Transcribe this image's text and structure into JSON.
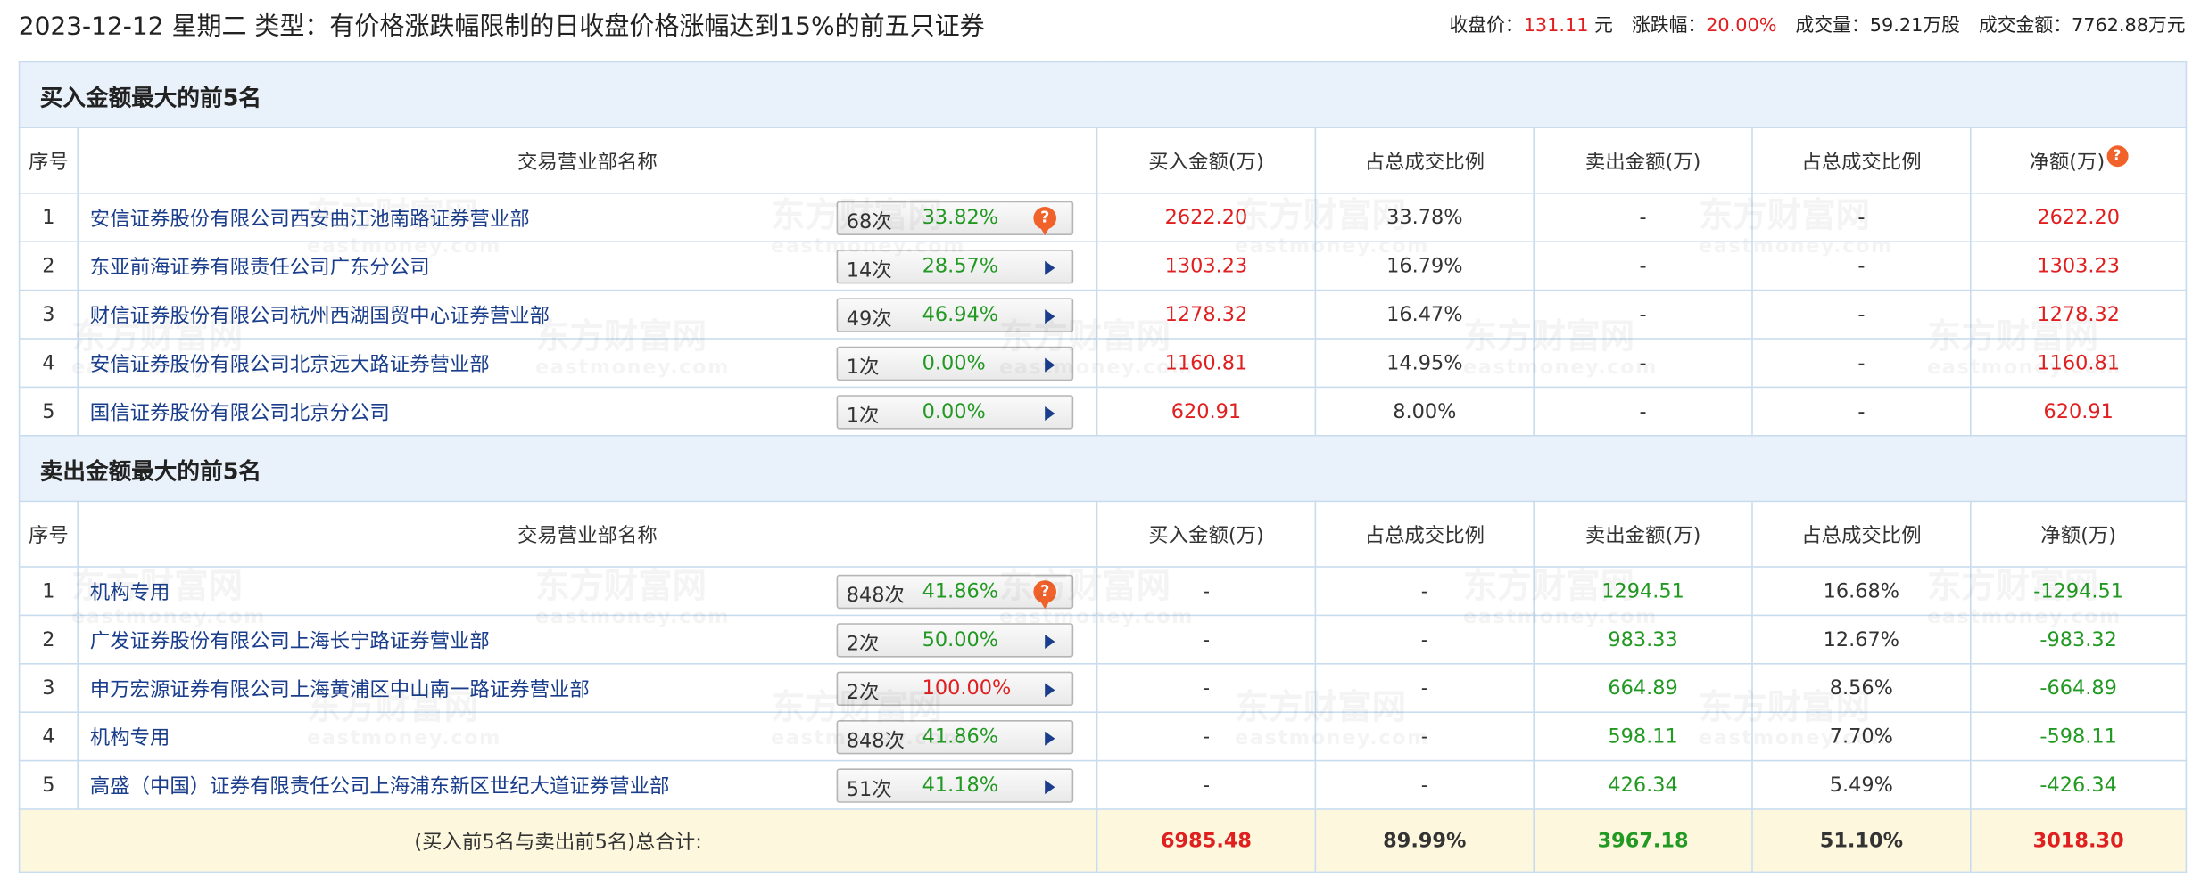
{
  "header": {
    "date": "2023-12-12",
    "weekday": "星期二",
    "type_label": "类型：",
    "type_value": "有价格涨跌幅限制的日收盘价格涨幅达到15%的前五只证券"
  },
  "summary": {
    "close_label": "收盘价：",
    "close_value": "131.11",
    "close_unit": "元",
    "change_label": "涨跌幅：",
    "change_value": "20.00%",
    "volume_label": "成交量：",
    "volume_value": "59.21万股",
    "amount_label": "成交金额：",
    "amount_value": "7762.88万元"
  },
  "columns": {
    "seq": "序号",
    "name": "交易营业部名称",
    "buy": "买入金额(万)",
    "buy_ratio": "占总成交比例",
    "sell": "卖出金额(万)",
    "sell_ratio": "占总成交比例",
    "net": "净额(万)"
  },
  "buy_section": {
    "title": "买入金额最大的前5名",
    "rows": [
      {
        "seq": "1",
        "name": "安信证券股份有限公司西安曲江池南路证券营业部",
        "count": "68次",
        "pct": "33.82%",
        "pct_color": "green",
        "icon": "question-bubble-icon",
        "buy": "2622.20",
        "buy_ratio": "33.78%",
        "sell": "-",
        "sell_ratio": "-",
        "net": "2622.20"
      },
      {
        "seq": "2",
        "name": "东亚前海证券有限责任公司广东分公司",
        "count": "14次",
        "pct": "28.57%",
        "pct_color": "green",
        "icon": "arrow-right-icon",
        "buy": "1303.23",
        "buy_ratio": "16.79%",
        "sell": "-",
        "sell_ratio": "-",
        "net": "1303.23"
      },
      {
        "seq": "3",
        "name": "财信证券股份有限公司杭州西湖国贸中心证券营业部",
        "count": "49次",
        "pct": "46.94%",
        "pct_color": "green",
        "icon": "arrow-right-icon",
        "buy": "1278.32",
        "buy_ratio": "16.47%",
        "sell": "-",
        "sell_ratio": "-",
        "net": "1278.32"
      },
      {
        "seq": "4",
        "name": "安信证券股份有限公司北京远大路证券营业部",
        "count": "1次",
        "pct": "0.00%",
        "pct_color": "green",
        "icon": "arrow-right-icon",
        "buy": "1160.81",
        "buy_ratio": "14.95%",
        "sell": "-",
        "sell_ratio": "-",
        "net": "1160.81"
      },
      {
        "seq": "5",
        "name": "国信证券股份有限公司北京分公司",
        "count": "1次",
        "pct": "0.00%",
        "pct_color": "green",
        "icon": "arrow-right-icon",
        "buy": "620.91",
        "buy_ratio": "8.00%",
        "sell": "-",
        "sell_ratio": "-",
        "net": "620.91"
      }
    ]
  },
  "sell_section": {
    "title": "卖出金额最大的前5名",
    "rows": [
      {
        "seq": "1",
        "name": "机构专用",
        "count": "848次",
        "pct": "41.86%",
        "pct_color": "green",
        "icon": "question-bubble-icon",
        "buy": "-",
        "buy_ratio": "-",
        "sell": "1294.51",
        "sell_ratio": "16.68%",
        "net": "-1294.51"
      },
      {
        "seq": "2",
        "name": "广发证券股份有限公司上海长宁路证券营业部",
        "count": "2次",
        "pct": "50.00%",
        "pct_color": "green",
        "icon": "arrow-right-icon",
        "buy": "-",
        "buy_ratio": "-",
        "sell": "983.33",
        "sell_ratio": "12.67%",
        "net": "-983.32"
      },
      {
        "seq": "3",
        "name": "申万宏源证券有限公司上海黄浦区中山南一路证券营业部",
        "count": "2次",
        "pct": "100.00%",
        "pct_color": "red",
        "icon": "arrow-right-icon",
        "buy": "-",
        "buy_ratio": "-",
        "sell": "664.89",
        "sell_ratio": "8.56%",
        "net": "-664.89"
      },
      {
        "seq": "4",
        "name": "机构专用",
        "count": "848次",
        "pct": "41.86%",
        "pct_color": "green",
        "icon": "arrow-right-icon",
        "buy": "-",
        "buy_ratio": "-",
        "sell": "598.11",
        "sell_ratio": "7.70%",
        "net": "-598.11"
      },
      {
        "seq": "5",
        "name": "高盛（中国）证券有限责任公司上海浦东新区世纪大道证券营业部",
        "count": "51次",
        "pct": "41.18%",
        "pct_color": "green",
        "icon": "arrow-right-icon",
        "buy": "-",
        "buy_ratio": "-",
        "sell": "426.34",
        "sell_ratio": "5.49%",
        "net": "-426.34"
      }
    ]
  },
  "total": {
    "label": "(买入前5名与卖出前5名)总合计:",
    "buy": "6985.48",
    "buy_ratio": "89.99%",
    "sell": "3967.18",
    "sell_ratio": "51.10%",
    "net": "3018.30"
  },
  "watermark": {
    "brand": "东方财富网",
    "domain": "eastmoney.com"
  },
  "colors": {
    "up": "#e02020",
    "down": "#229922",
    "link": "#1a3e8c",
    "section_bg": "#e9f1fa",
    "total_bg": "#fdf8dd",
    "icon_accent": "#f0622a"
  }
}
